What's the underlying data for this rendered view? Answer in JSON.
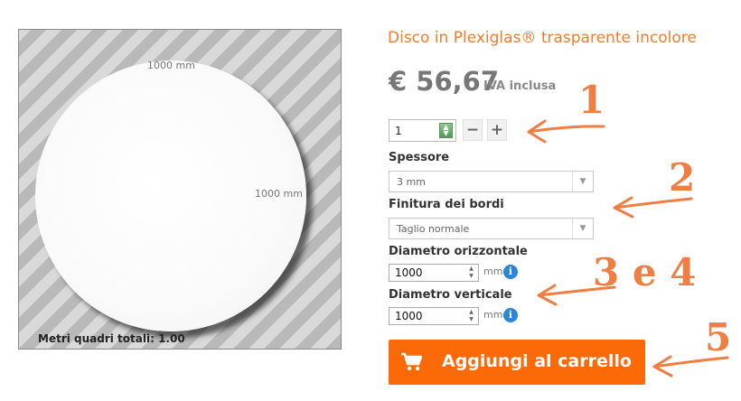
{
  "preview": {
    "dim_top": "1000 mm",
    "dim_right": "1000 mm",
    "area_label": "Metri quadri totali: 1.00"
  },
  "product": {
    "title": "Disco in Plexiglas® trasparente incolore",
    "price": "€ 56,67",
    "vat": "IVA inclusa"
  },
  "quantity": {
    "value": "1",
    "minus": "−",
    "plus": "+"
  },
  "options": {
    "thickness_label": "Spessore",
    "thickness_value": "3 mm",
    "edges_label": "Finitura dei bordi",
    "edges_value": "Taglio normale",
    "diam_h_label": "Diametro orizzontale",
    "diam_h_value": "1000",
    "diam_v_label": "Diametro verticale",
    "diam_v_value": "1000",
    "unit": "mm",
    "info": "i"
  },
  "cart": {
    "label": "Aggiungi al carrello"
  },
  "annotations": {
    "a1": "1",
    "a2": "2",
    "a34": "3 e 4",
    "a5": "5"
  },
  "colors": {
    "accent": "#f07d2d",
    "cart": "#fb6a07",
    "info": "#2a86d9"
  },
  "icons": [
    "cart-icon",
    "spinner-icon",
    "dropdown-arrow-icon",
    "info-icon",
    "arrow-annotation-icon"
  ]
}
